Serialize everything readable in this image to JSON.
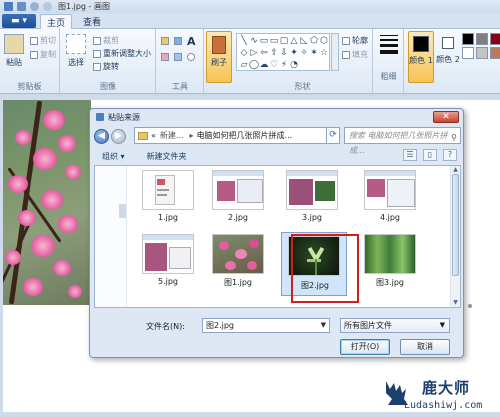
{
  "window": {
    "title": "图1.jpg - 画图"
  },
  "tabs": [
    {
      "label": "主页",
      "active": true
    },
    {
      "label": "查看",
      "active": false
    }
  ],
  "ribbon": {
    "clipboard": {
      "paste": "粘贴",
      "cut": "剪切",
      "copy": "复制",
      "label": "剪贴板"
    },
    "image": {
      "select": "选择",
      "crop": "裁剪",
      "resize": "重新调整大小",
      "rotate": "旋转",
      "label": "图像"
    },
    "tools": {
      "label": "工具"
    },
    "brushes": {
      "label": "刷子"
    },
    "shapes": {
      "outline": "轮廓",
      "fill": "填充",
      "label": "形状",
      "glyphs": [
        "╲",
        "∿",
        "▭",
        "▭",
        "▢",
        "△",
        "◺",
        "⬠",
        "⬡",
        "◇",
        "▷",
        "⇦",
        "⇧",
        "⇩",
        "✦",
        "✧",
        "✶",
        "☆",
        "▱",
        "◯",
        "☁",
        "♡",
        "⚡",
        "◔"
      ]
    },
    "size": {
      "label": "粗细"
    },
    "colors": {
      "color1": "颜色 1",
      "color2": "颜色 2",
      "color1_value": "#000000",
      "color2_value": "#ffffff",
      "palette": [
        "#000000",
        "#7f7f7f",
        "#880015",
        "#ffffff",
        "#c3c3c3",
        "#b97a57"
      ]
    }
  },
  "dialog": {
    "title": "粘贴来源",
    "close": "✕",
    "address": {
      "prefix": "«",
      "part1": "新建...",
      "part2": "电脑如何把几张照片拼成..."
    },
    "search_placeholder": "搜索 电脑如何把几张照片拼成...",
    "toolbar": {
      "organize": "组织 ▾",
      "new_folder": "新建文件夹"
    },
    "files": [
      {
        "name": "1.jpg"
      },
      {
        "name": "2.jpg"
      },
      {
        "name": "3.jpg"
      },
      {
        "name": "4.jpg"
      },
      {
        "name": "5.jpg"
      },
      {
        "name": "图1.jpg"
      },
      {
        "name": "图2.jpg",
        "selected": true
      },
      {
        "name": "图3.jpg"
      }
    ],
    "filename_label": "文件名(N):",
    "filename_value": "图2.jpg",
    "filetype_value": "所有图片文件",
    "open_button": "打开(O)",
    "cancel_button": "取消"
  },
  "watermark": {
    "brand": "鹿大师",
    "url": "Ludashiwj.com"
  }
}
